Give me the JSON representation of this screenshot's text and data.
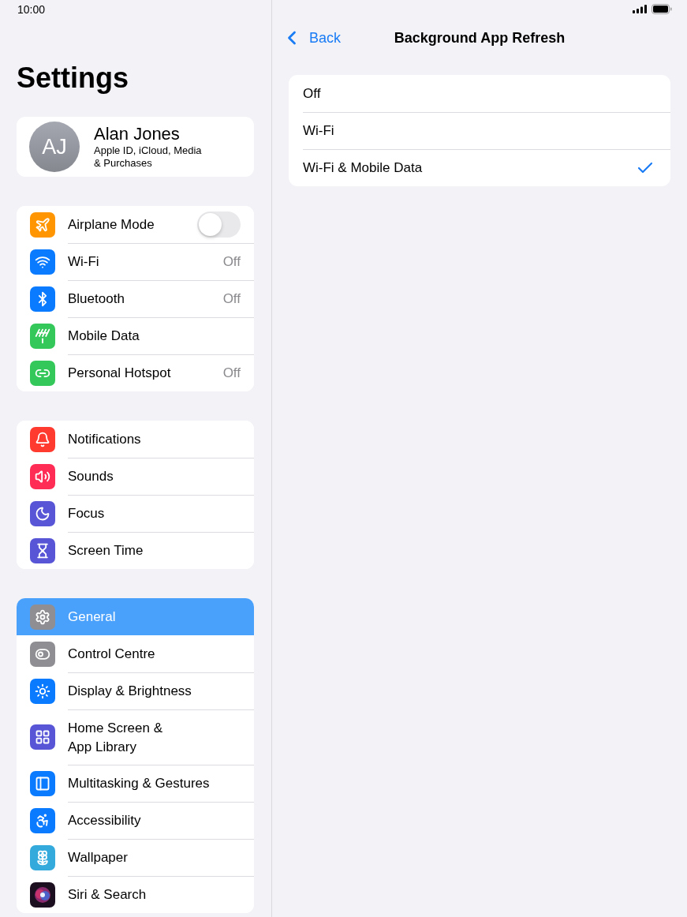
{
  "status_bar": {
    "time": "10:00"
  },
  "sidebar": {
    "title": "Settings",
    "account": {
      "initials": "AJ",
      "name": "Alan Jones",
      "subtitle": "Apple ID, iCloud, Media\n& Purchases"
    },
    "groups": [
      {
        "items": [
          {
            "kind": "toggle",
            "label": "Airplane Mode",
            "on": false,
            "selected": false
          },
          {
            "kind": "link",
            "label": "Wi-Fi",
            "value": "Off",
            "selected": false
          },
          {
            "kind": "link",
            "label": "Bluetooth",
            "value": "Off",
            "selected": false
          },
          {
            "kind": "link",
            "label": "Mobile Data",
            "selected": false
          },
          {
            "kind": "link",
            "label": "Personal Hotspot",
            "value": "Off",
            "selected": false
          }
        ]
      },
      {
        "items": [
          {
            "kind": "link",
            "label": "Notifications",
            "selected": false
          },
          {
            "kind": "link",
            "label": "Sounds",
            "selected": false
          },
          {
            "kind": "link",
            "label": "Focus",
            "selected": false
          },
          {
            "kind": "link",
            "label": "Screen Time",
            "selected": false
          }
        ]
      },
      {
        "items": [
          {
            "kind": "link",
            "label": "General",
            "selected": true
          },
          {
            "kind": "link",
            "label": "Control Centre",
            "selected": false
          },
          {
            "kind": "link",
            "label": "Display & Brightness",
            "selected": false
          },
          {
            "kind": "link",
            "label": "Home Screen &\nApp Library",
            "selected": false
          },
          {
            "kind": "link",
            "label": "Multitasking & Gestures",
            "selected": false
          },
          {
            "kind": "link",
            "label": "Accessibility",
            "selected": false
          },
          {
            "kind": "link",
            "label": "Wallpaper",
            "selected": false
          },
          {
            "kind": "link",
            "label": "Siri & Search",
            "selected": false
          }
        ]
      }
    ]
  },
  "detail": {
    "back": "Back",
    "title": "Background App Refresh",
    "options": [
      {
        "label": "Off",
        "selected": false
      },
      {
        "label": "Wi-Fi",
        "selected": false
      },
      {
        "label": "Wi-Fi & Mobile Data",
        "selected": true
      }
    ]
  }
}
